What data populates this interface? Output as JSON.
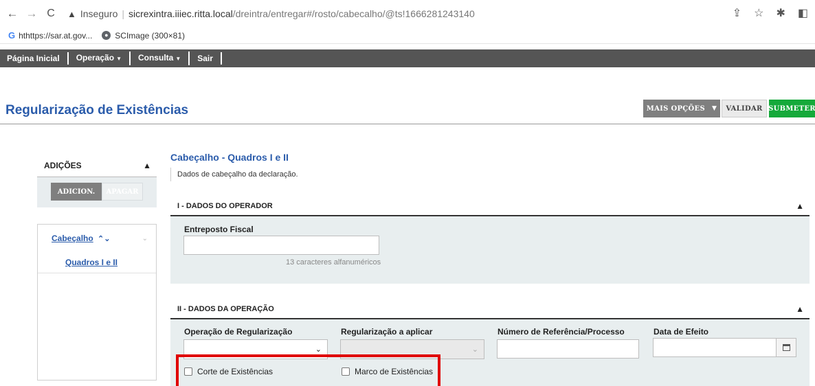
{
  "browser": {
    "insecure_label": "Inseguro",
    "url_host": "sicrexintra.iiiec.ritta.local",
    "url_path": "/dreintra/entregar#/rosto/cabecalho/@ts!1666281243140",
    "bookmarks": [
      {
        "label": "hthttps://sar.at.gov..."
      },
      {
        "label": "SCImage (300×81)"
      }
    ]
  },
  "menu": {
    "items": [
      {
        "label": "Página Inicial"
      },
      {
        "label": "Operação"
      },
      {
        "label": "Consulta"
      },
      {
        "label": "Sair"
      }
    ]
  },
  "page": {
    "title": "Regularização de Existências"
  },
  "toolbar": {
    "more_label": "MAIS OPÇÕES",
    "validate_label": "VALIDAR",
    "submit_label": "SUBMETER"
  },
  "sidebar": {
    "header": "ADIÇÕES",
    "add_label": "ADICION.",
    "delete_label": "APAGAR",
    "tree": {
      "parent": "Cabeçalho",
      "child": "Quadros I e II"
    }
  },
  "section": {
    "title": "Cabeçalho - Quadros I e II",
    "description": "Dados de cabeçalho da declaração."
  },
  "panel1": {
    "header": "I - DADOS DO OPERADOR",
    "field_label": "Entreposto Fiscal",
    "field_value": "",
    "hint": "13 caracteres alfanuméricos"
  },
  "panel2": {
    "header": "II - DADOS DA OPERAÇÃO",
    "op_label": "Operação de Regularização",
    "reg_label": "Regularização a aplicar",
    "ref_label": "Número de Referência/Processo",
    "date_label": "Data de Efeito",
    "checkbox1": "Corte de Existências",
    "checkbox2": "Marco de Existências"
  }
}
